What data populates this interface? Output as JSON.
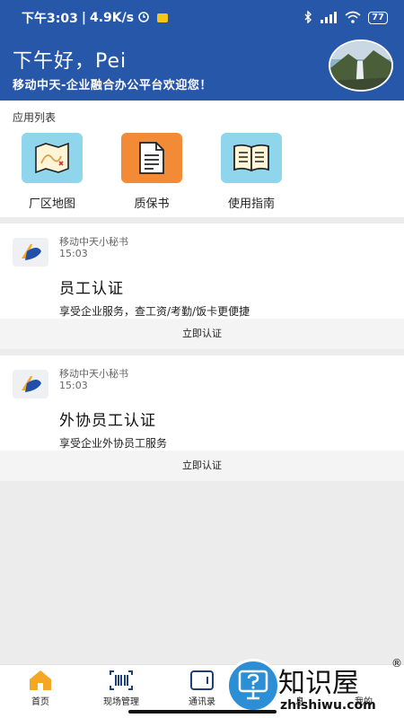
{
  "status_bar": {
    "time": "下午3:03",
    "network_speed": "4.9K/s",
    "battery": "77"
  },
  "header": {
    "greeting": "下午好，Pei",
    "welcome": "移动中天-企业融合办公平台欢迎您！"
  },
  "apps": {
    "title": "应用列表",
    "items": [
      {
        "label": "厂区地图",
        "icon": "map-icon",
        "color": "#8fd6ec"
      },
      {
        "label": "质保书",
        "icon": "document-icon",
        "color": "#f38a36"
      },
      {
        "label": "使用指南",
        "icon": "book-icon",
        "color": "#8fd6ec"
      }
    ]
  },
  "cards": [
    {
      "sender": "移动中天小秘书",
      "time": "15:03",
      "title": "员工认证",
      "description": "享受企业服务，查工资/考勤/饭卡更便捷",
      "action": "立即认证"
    },
    {
      "sender": "移动中天小秘书",
      "time": "15:03",
      "title": "外协员工认证",
      "description": "享受企业外协员工服务",
      "action": "立即认证"
    }
  ],
  "bottom_nav": {
    "items": [
      {
        "label": "首页",
        "icon": "home-icon",
        "active": true
      },
      {
        "label": "现场管理",
        "icon": "barcode-icon"
      },
      {
        "label": "通讯录",
        "icon": "contacts-icon"
      },
      {
        "label": "息",
        "icon": "message-icon"
      },
      {
        "label": "我的",
        "icon": "profile-icon"
      }
    ]
  },
  "watermark": {
    "text": "知识屋",
    "url": "zhishiwu.com",
    "reg": "®"
  },
  "colors": {
    "header_bg": "#2757a8",
    "home_active": "#f5a623",
    "watermark_blue": "#2c8fd6"
  }
}
